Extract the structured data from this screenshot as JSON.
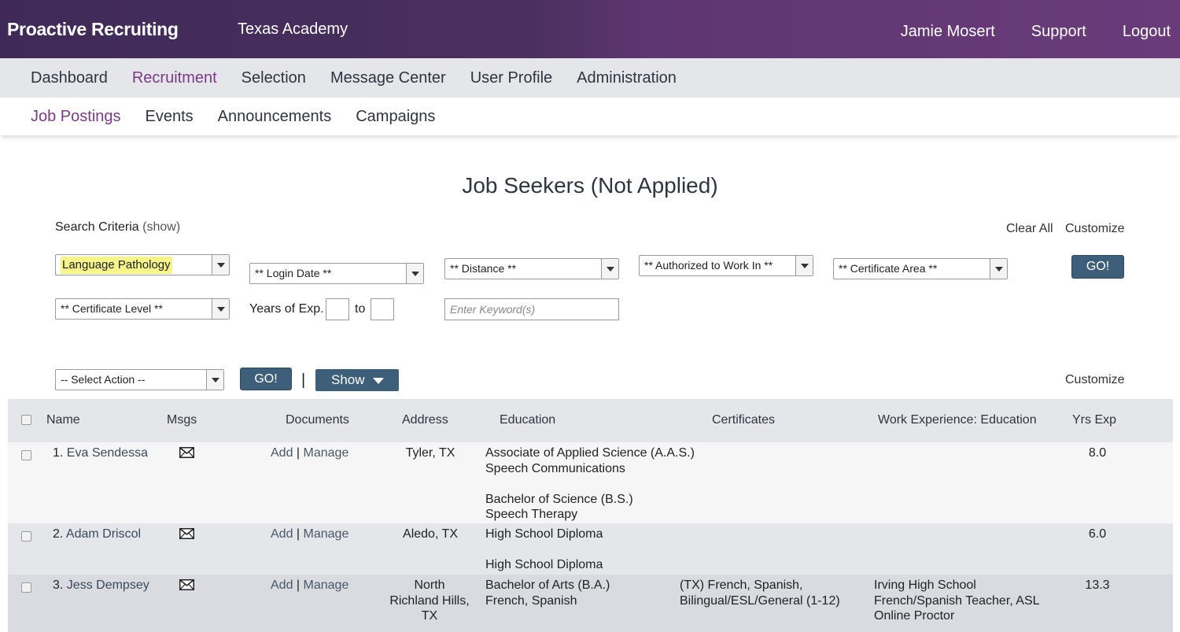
{
  "header": {
    "brand": "Proactive Recruiting",
    "org": "Texas Academy",
    "user": "Jamie Mosert",
    "support": "Support",
    "logout": "Logout"
  },
  "main_nav": [
    "Dashboard",
    "Recruitment",
    "Selection",
    "Message Center",
    "User Profile",
    "Administration"
  ],
  "sub_nav": [
    "Job Postings",
    "Events",
    "Announcements",
    "Campaigns"
  ],
  "page_title": "Job Seekers (Not Applied)",
  "search": {
    "label": "Search Criteria",
    "show": "(show)",
    "clear_all": "Clear All",
    "customize": "Customize",
    "area_value": "Language Pathology",
    "login_date": "** Login Date **",
    "distance": "** Distance **",
    "authorized": "** Authorized to Work In **",
    "certificate_area": "** Certificate Area **",
    "go": "GO!",
    "certificate_level": "** Certificate Level **",
    "years_label": "Years of Exp.",
    "to_label": "to",
    "keyword_placeholder": "Enter Keyword(s)"
  },
  "actions": {
    "select_action": "-- Select Action --",
    "go": "GO!",
    "pipe": "|",
    "show": "Show",
    "customize": "Customize"
  },
  "table": {
    "headers": {
      "name": "Name",
      "msgs": "Msgs",
      "documents": "Documents",
      "address": "Address",
      "education": "Education",
      "certificates": "Certificates",
      "work": "Work Experience: Education",
      "yrs": "Yrs Exp"
    },
    "add": "Add",
    "sep": "|",
    "manage": "Manage",
    "rows": [
      {
        "num": "1.",
        "name": "Eva Sendessa",
        "address": [
          "Tyler, TX"
        ],
        "education": [
          "Associate of Applied Science (A.A.S.)",
          "Speech Communications",
          "",
          "Bachelor of Science (B.S.)",
          "Speech Therapy"
        ],
        "certificates": [],
        "work": [],
        "yrs": "8.0"
      },
      {
        "num": "2.",
        "name": "Adam Driscol",
        "address": [
          "Aledo, TX"
        ],
        "education": [
          "High School Diploma",
          "",
          "High School Diploma"
        ],
        "certificates": [],
        "work": [],
        "yrs": "6.0"
      },
      {
        "num": "3.",
        "name": "Jess Dempsey",
        "address": [
          "North",
          "Richland Hills,",
          "TX"
        ],
        "education": [
          "Bachelor of Arts (B.A.)",
          "French, Spanish"
        ],
        "certificates": [
          "(TX) French, Spanish,",
          "Bilingual/ESL/General (1-12)"
        ],
        "work": [
          "Irving High School",
          "French/Spanish Teacher, ASL",
          "Online Proctor"
        ],
        "yrs": "13.3"
      }
    ]
  }
}
